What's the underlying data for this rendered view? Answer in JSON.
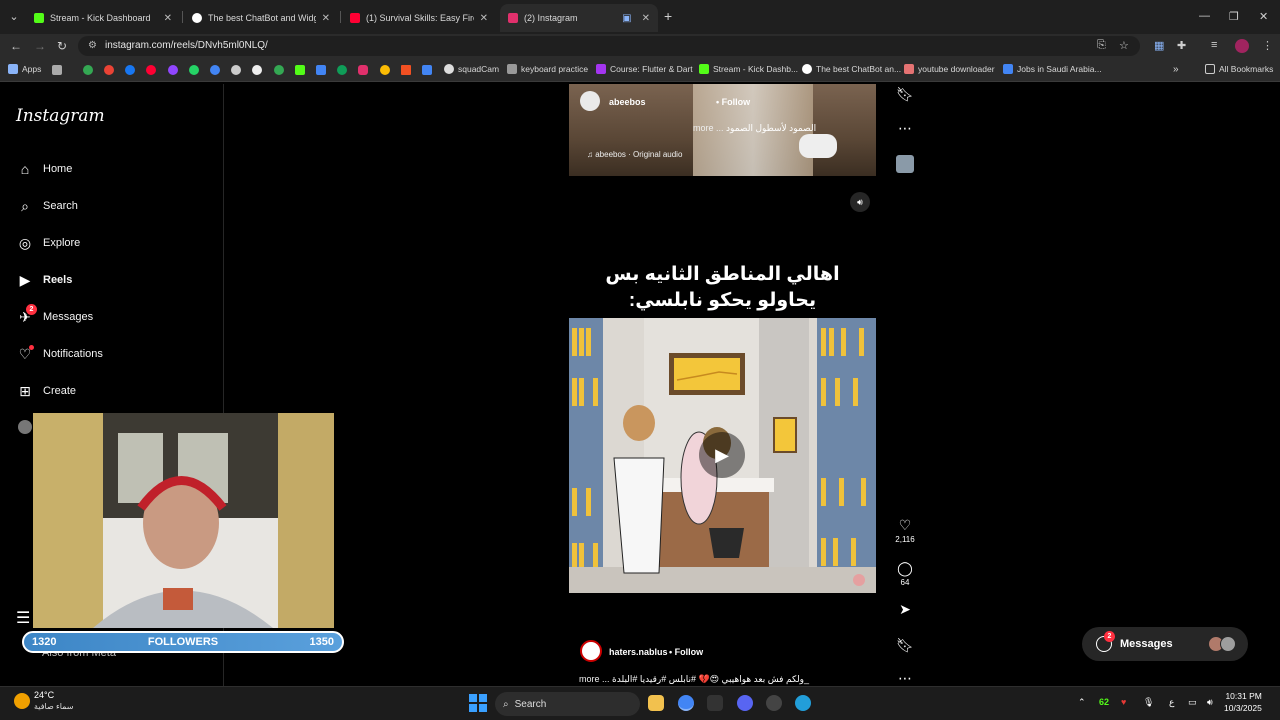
{
  "browser": {
    "tabs": [
      {
        "title": "Stream - Kick Dashboard",
        "color": "#53fc18"
      },
      {
        "title": "The best ChatBot and Widgets",
        "color": "#ffffff"
      },
      {
        "title": "(1) Survival Skills: Easy Firestarti",
        "color": "#ff0033"
      },
      {
        "title": "(2) Instagram",
        "color": "#e1306c"
      }
    ],
    "url": "instagram.com/reels/DNvh5ml0NLQ/",
    "bookmarks": {
      "apps": "Apps",
      "squadcam": "squadCam",
      "keyboard": "keyboard practice",
      "course": "Course: Flutter & Dart",
      "kick": "Stream - Kick Dashb...",
      "chatbot": "The best ChatBot an...",
      "ytdl": "youtube downloader",
      "jobs": "Jobs in Saudi Arabia...",
      "all": "All Bookmarks"
    }
  },
  "instagram": {
    "logo": "Instagram",
    "nav": [
      {
        "label": "Home",
        "icon": "home-icon"
      },
      {
        "label": "Search",
        "icon": "search-icon"
      },
      {
        "label": "Explore",
        "icon": "compass-icon"
      },
      {
        "label": "Reels",
        "icon": "reels-icon"
      },
      {
        "label": "Messages",
        "icon": "messenger-icon",
        "badge": "2"
      },
      {
        "label": "Notifications",
        "icon": "heart-icon"
      },
      {
        "label": "Create",
        "icon": "plus-square-icon"
      }
    ],
    "also_from_meta": "Also from Meta",
    "reel1": {
      "user": "abeebos",
      "follow": "Follow",
      "caption": "الصمود لأسطول الصمود",
      "more": "more ...",
      "audio": "abeebos · Original audio"
    },
    "reel2": {
      "title_line1": "اهالي المناطق الثانيه بس",
      "title_line2": "يحاولو يحكو نابلسي:",
      "likes": "2,116",
      "comments": "64",
      "user": "haters.nablus",
      "follow": "Follow",
      "caption": "ولكم فش بعد هواهيبي 😍💔 #نابلس #رقيديا #البلدة_",
      "more": "more ..."
    },
    "messages_pill": {
      "label": "Messages",
      "badge": "2"
    }
  },
  "overlay": {
    "followers_label": "FOLLOWERS",
    "current": "1320",
    "goal": "1350"
  },
  "taskbar": {
    "temp": "24°C",
    "weather": "سماء صافية",
    "search": "Search",
    "tray_num": "62",
    "lang": "ع",
    "time": "10:31 PM",
    "date": "10/3/2025"
  }
}
